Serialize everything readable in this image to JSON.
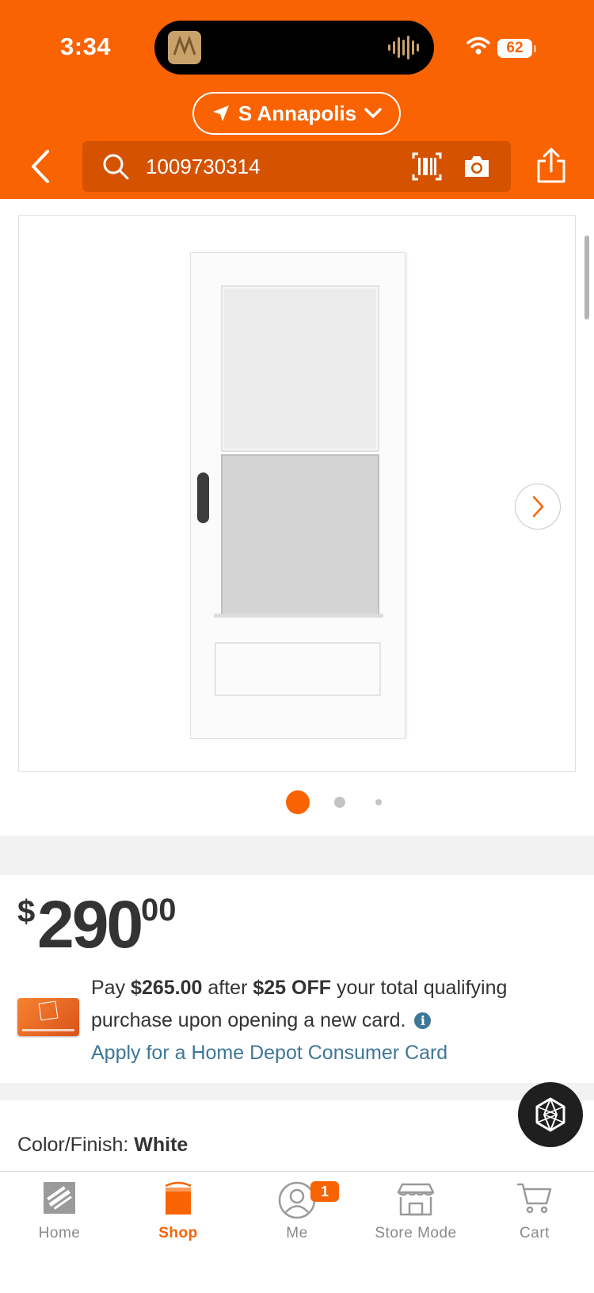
{
  "status_bar": {
    "time": "3:34",
    "battery": "62"
  },
  "header": {
    "store_name": "S Annapolis",
    "search_value": "1009730314"
  },
  "gallery": {
    "image_count": 3,
    "selected_index": 0
  },
  "price": {
    "currency": "$",
    "dollars": "290",
    "cents": "00"
  },
  "promo": {
    "pay_prefix": "Pay",
    "pay_amount": "$265.00",
    "after_text": "after",
    "off_amount": "$25 OFF",
    "rest_text": "your total qualifying purchase upon opening a new card.",
    "info_glyph": "i",
    "apply_link": "Apply for a Home Depot Consumer Card"
  },
  "options": {
    "color_label": "Color/Finish:",
    "color_value": "White"
  },
  "tabbar": {
    "items": [
      {
        "label": "Home",
        "icon": "home-depot-logo-icon"
      },
      {
        "label": "Shop",
        "icon": "bucket-icon",
        "active": true
      },
      {
        "label": "Me",
        "icon": "user-icon",
        "badge": "1"
      },
      {
        "label": "Store Mode",
        "icon": "store-icon"
      },
      {
        "label": "Cart",
        "icon": "cart-icon"
      }
    ]
  },
  "colors": {
    "brand_orange": "#f96302",
    "link_blue": "#3e7697",
    "text": "#333333"
  }
}
